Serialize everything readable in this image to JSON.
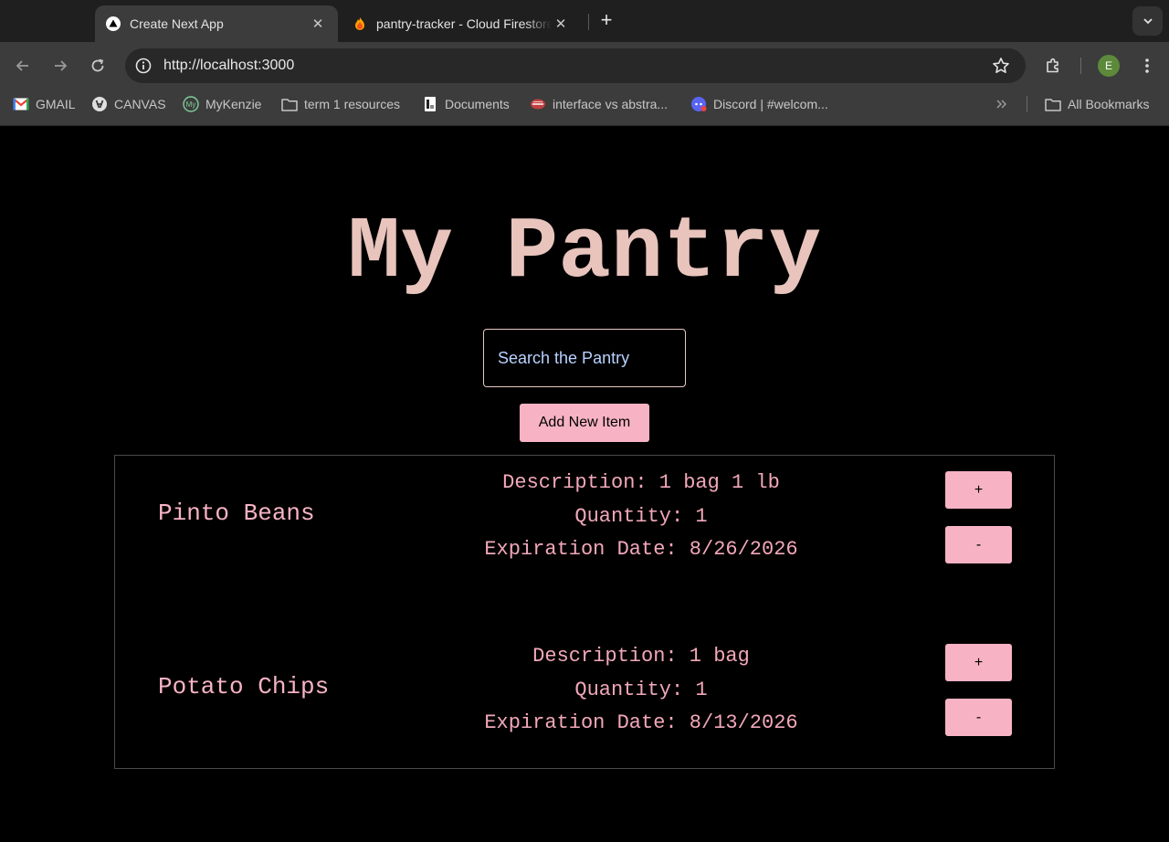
{
  "browser": {
    "tabs": [
      {
        "title": "Create Next App",
        "favicon": "nextjs-triangle-icon",
        "active": true
      },
      {
        "title": "pantry-tracker - Cloud Firestore",
        "favicon": "firebase-flame-icon",
        "active": false
      }
    ],
    "url": "http://localhost:3000",
    "profile_initial": "E",
    "bookmarks": [
      {
        "label": "GMAIL",
        "icon": "gmail-icon"
      },
      {
        "label": "CANVAS",
        "icon": "canvas-icon"
      },
      {
        "label": "MyKenzie",
        "icon": "mykenzie-icon",
        "icon_text": "My"
      },
      {
        "label": "term 1 resources",
        "icon": "folder-icon"
      },
      {
        "label": "Documents",
        "icon": "document-icon"
      },
      {
        "label": "interface vs abstra...",
        "icon": "site-icon"
      },
      {
        "label": "Discord | #welcom...",
        "icon": "discord-icon"
      }
    ],
    "all_bookmarks_label": "All Bookmarks",
    "colors": {
      "tabstrip": "#1f1f1f",
      "toolbar": "#3c3c3c",
      "omnibox": "#282828"
    }
  },
  "page": {
    "title": "My Pantry",
    "search_placeholder": "Search the Pantry",
    "add_button_label": "Add New Item",
    "colors": {
      "accent": "#f7b3c4",
      "title": "#e8c4bd",
      "text": "#f2a8b9",
      "background": "#000000"
    },
    "items": [
      {
        "name": "Pinto Beans",
        "description": "Description: 1 bag 1 lb",
        "quantity": "Quantity: 1",
        "expiration": "Expiration Date: 8/26/2026",
        "increment_label": "+",
        "decrement_label": "-"
      },
      {
        "name": "Potato Chips",
        "description": "Description: 1 bag",
        "quantity": "Quantity: 1",
        "expiration": "Expiration Date: 8/13/2026",
        "increment_label": "+",
        "decrement_label": "-"
      }
    ]
  }
}
